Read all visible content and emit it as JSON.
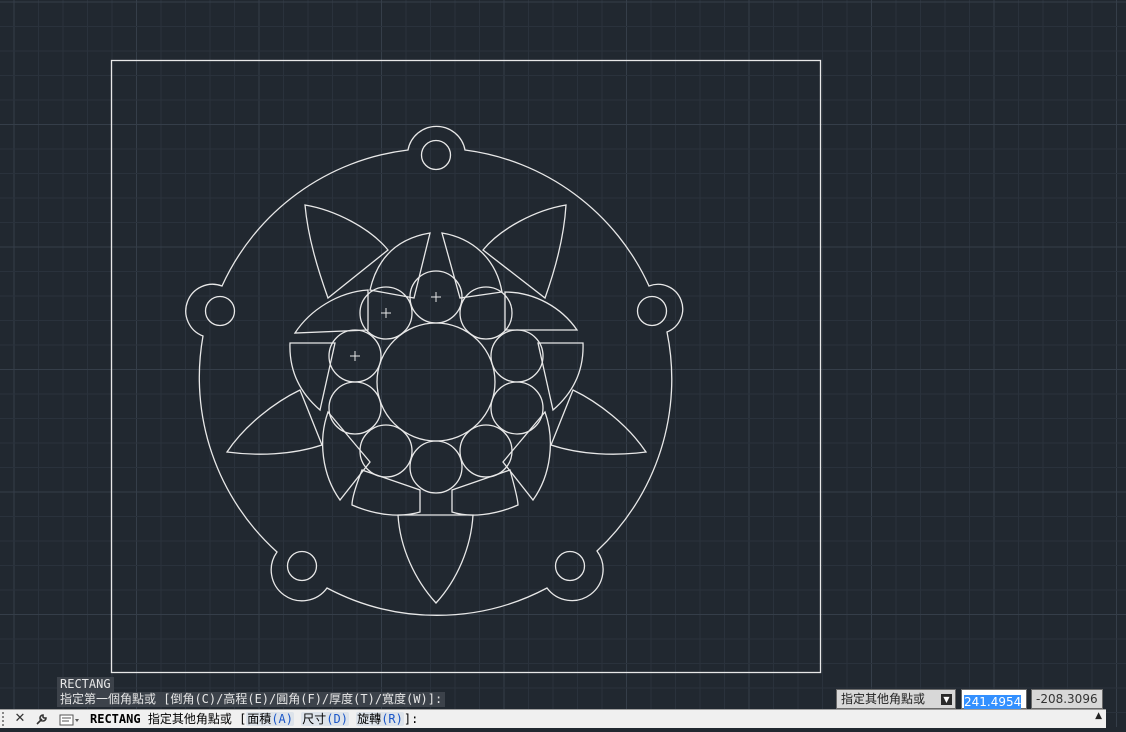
{
  "command_history": [
    "RECTANG",
    "指定第一個角點或 [倒角(C)/高程(E)/圓角(F)/厚度(T)/寬度(W)]:"
  ],
  "command_line": {
    "command": "RECTANG",
    "prompt": "指定其他角點或",
    "bracket_open": "[",
    "options": [
      {
        "label": "面積",
        "key": "(A)"
      },
      {
        "label": "尺寸",
        "key": "(D)"
      },
      {
        "label": "旋轉",
        "key": "(R)"
      }
    ],
    "bracket_close": "]:"
  },
  "dynamic_input": {
    "prompt": "指定其他角點或",
    "x_value": "241.4954",
    "y_value": "-208.3096"
  },
  "icons": {
    "close": "close-icon",
    "customize": "wrench-icon",
    "command_history": "command-icon",
    "prompt_dropdown": "dropdown-arrow-icon",
    "scroll_up": "scroll-up-icon"
  },
  "colors": {
    "background": "#212830",
    "grid_minor": "#2a323c",
    "grid_major": "#353e49",
    "drawing": "#e8e8e8",
    "selection": "#3390ff"
  }
}
